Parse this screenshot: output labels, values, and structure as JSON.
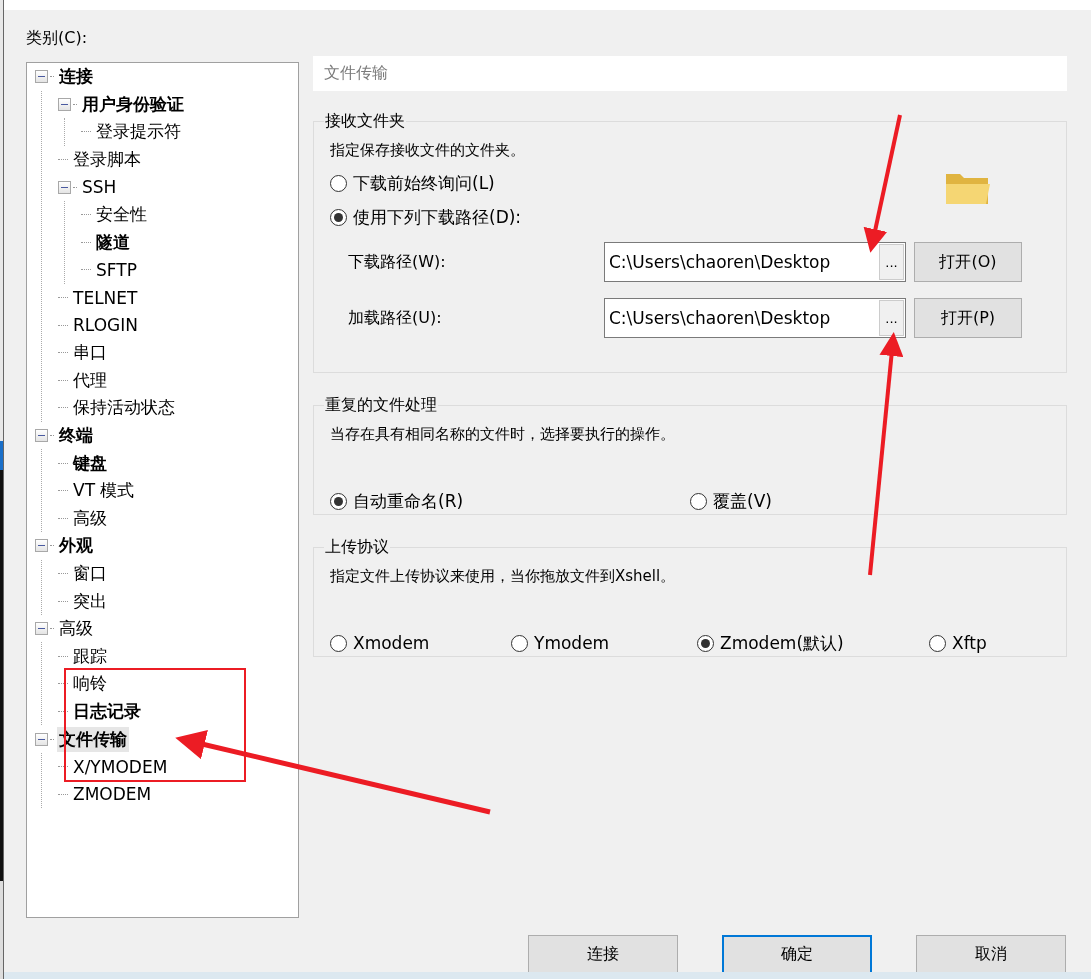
{
  "category_label": "类别(C):",
  "tree": [
    {
      "label": "连接",
      "bold": true,
      "selected": false,
      "expanded": true,
      "children": [
        {
          "label": "用户身份验证",
          "bold": true,
          "selected": false,
          "expanded": true,
          "children": [
            {
              "label": "登录提示符",
              "bold": false,
              "selected": false
            }
          ]
        },
        {
          "label": "登录脚本",
          "bold": false,
          "selected": false
        },
        {
          "label": "SSH",
          "bold": false,
          "selected": false,
          "expanded": true,
          "children": [
            {
              "label": "安全性",
              "bold": false,
              "selected": false
            },
            {
              "label": "隧道",
              "bold": true,
              "selected": false
            },
            {
              "label": "SFTP",
              "bold": false,
              "selected": false
            }
          ]
        },
        {
          "label": "TELNET",
          "bold": false,
          "selected": false
        },
        {
          "label": "RLOGIN",
          "bold": false,
          "selected": false
        },
        {
          "label": "串口",
          "bold": false,
          "selected": false
        },
        {
          "label": "代理",
          "bold": false,
          "selected": false
        },
        {
          "label": "保持活动状态",
          "bold": false,
          "selected": false
        }
      ]
    },
    {
      "label": "终端",
      "bold": true,
      "selected": false,
      "expanded": true,
      "children": [
        {
          "label": "键盘",
          "bold": true,
          "selected": false
        },
        {
          "label": "VT 模式",
          "bold": false,
          "selected": false
        },
        {
          "label": "高级",
          "bold": false,
          "selected": false
        }
      ]
    },
    {
      "label": "外观",
      "bold": true,
      "selected": false,
      "expanded": true,
      "children": [
        {
          "label": "窗口",
          "bold": false,
          "selected": false
        },
        {
          "label": "突出",
          "bold": false,
          "selected": false
        }
      ]
    },
    {
      "label": "高级",
      "bold": false,
      "selected": false,
      "expanded": true,
      "children": [
        {
          "label": "跟踪",
          "bold": false,
          "selected": false
        },
        {
          "label": "响铃",
          "bold": false,
          "selected": false
        },
        {
          "label": "日志记录",
          "bold": true,
          "selected": false
        }
      ]
    },
    {
      "label": "文件传输",
      "bold": true,
      "selected": true,
      "expanded": true,
      "children": [
        {
          "label": "X/YMODEM",
          "bold": false,
          "selected": false
        },
        {
          "label": "ZMODEM",
          "bold": false,
          "selected": false
        }
      ]
    }
  ],
  "page_title": "文件传输",
  "receive_folder": {
    "title": "接收文件夹",
    "description": "指定保存接收文件的文件夹。",
    "options": [
      {
        "label": "下载前始终询问(L)",
        "selected": false
      },
      {
        "label": "使用下列下载路径(D):",
        "selected": true
      }
    ],
    "paths": [
      {
        "label": "下载路径(W):",
        "value": "C:\\Users\\chaoren\\Desktop",
        "browse": "...",
        "open": "打开(O)"
      },
      {
        "label": "加载路径(U):",
        "value": "C:\\Users\\chaoren\\Desktop",
        "browse": "...",
        "open": "打开(P)"
      }
    ]
  },
  "duplicate": {
    "title": "重复的文件处理",
    "description": "当存在具有相同名称的文件时，选择要执行的操作。",
    "options": [
      {
        "label": "自动重命名(R)",
        "selected": true
      },
      {
        "label": "覆盖(V)",
        "selected": false
      }
    ]
  },
  "upload": {
    "title": "上传协议",
    "description": "指定文件上传协议来使用，当你拖放文件到Xshell。",
    "options": [
      {
        "label": "Xmodem",
        "selected": false
      },
      {
        "label": "Ymodem",
        "selected": false
      },
      {
        "label": "Zmodem(默认)",
        "selected": true
      },
      {
        "label": "Xftp",
        "selected": false
      }
    ]
  },
  "buttons": [
    {
      "label": "连接",
      "focused": false
    },
    {
      "label": "确定",
      "focused": true
    },
    {
      "label": "取消",
      "focused": false
    }
  ]
}
